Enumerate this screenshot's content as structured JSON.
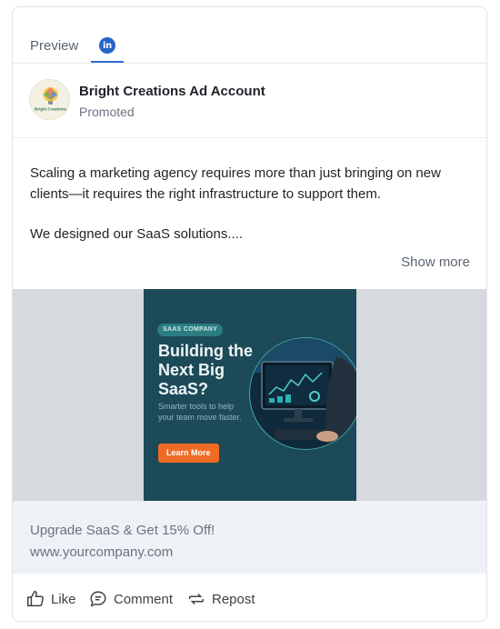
{
  "tabs": {
    "preview_label": "Preview",
    "linkedin_icon": "linkedin-icon",
    "linkedin_glyph": "in"
  },
  "account": {
    "name": "Bright Creations Ad Account",
    "subtitle": "Promoted",
    "avatar_text": "Bright Creations"
  },
  "post": {
    "paragraph1": "Scaling a marketing agency requires more than just bringing on new clients—it requires the right infrastructure to support them.",
    "paragraph2": "We designed our SaaS solutions....",
    "show_more": "Show more"
  },
  "creative": {
    "badge": "SAAS COMPANY",
    "title": "Building the Next Big SaaS?",
    "subtitle": "Smarter tools to help your team move faster.",
    "button": "Learn More",
    "colors": {
      "background": "#1d4a58",
      "button": "#ef6b24",
      "badge": "#2b7d80"
    }
  },
  "link": {
    "headline": "Upgrade SaaS & Get 15% Off!",
    "url": "www.yourcompany.com"
  },
  "actions": {
    "like": "Like",
    "comment": "Comment",
    "repost": "Repost"
  },
  "colors": {
    "accent": "#2f6bd8",
    "linkedin": "#2563c9"
  }
}
